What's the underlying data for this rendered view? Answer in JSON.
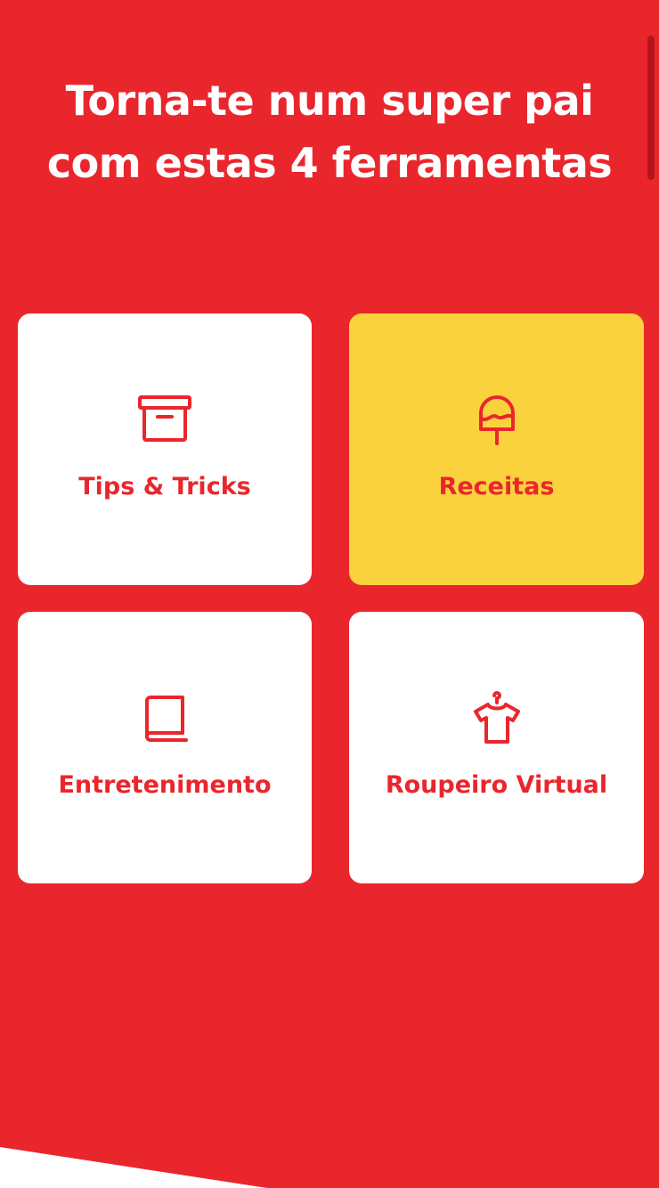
{
  "page": {
    "headline_line1": "Torna-te num super pai",
    "headline_line2": "com estas 4 ferramentas"
  },
  "tools": [
    {
      "label": "Tips & Tricks",
      "icon": "archive-box-icon",
      "selected": false
    },
    {
      "label": "Receitas",
      "icon": "ice-cream-popsicle-icon",
      "selected": true
    },
    {
      "label": "Entretenimento",
      "icon": "book-icon",
      "selected": false
    },
    {
      "label": "Roupeiro Virtual",
      "icon": "t-shirt-hanger-icon",
      "selected": false
    }
  ],
  "colors": {
    "background": "#ea262d",
    "card": "#ffffff",
    "card_selected": "#f9d23d",
    "accent": "#ea262d"
  }
}
